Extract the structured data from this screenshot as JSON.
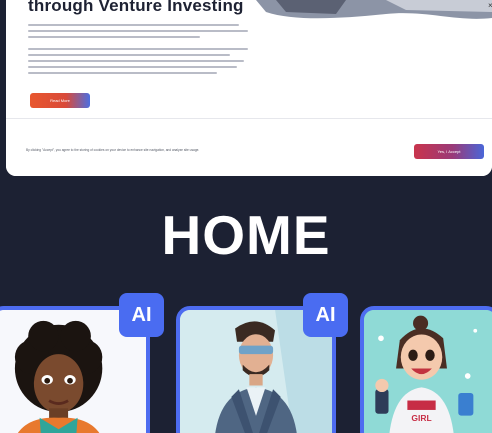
{
  "hero": {
    "title": "through Venture Investing",
    "read_more_label": "Read More"
  },
  "cookie": {
    "text": "By clicking \"Accept\", you agree to the storing of cookies on your device to enhance site navigation, and analyze site usage.",
    "accept_label": "Yes, I Accept",
    "close_label": "×"
  },
  "home": {
    "title": "HOME"
  },
  "cards": [
    {
      "badge": "AI"
    },
    {
      "badge": "AI"
    },
    {
      "shirt_text": "GIRL"
    }
  ],
  "colors": {
    "background": "#1c2133",
    "card_border": "#4d6cf0",
    "badge": "#4a6cf1"
  }
}
